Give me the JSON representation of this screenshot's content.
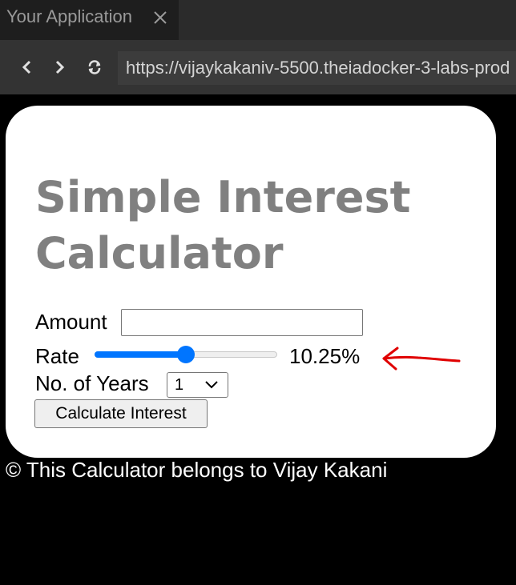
{
  "browser": {
    "tab_title": "Your Application",
    "url": "https://vijaykakaniv-5500.theiadocker-3-labs-prod",
    "icons": [
      "close-icon",
      "back-icon",
      "forward-icon",
      "reload-icon"
    ]
  },
  "calculator": {
    "title": "Simple Interest Calculator",
    "amount_label": "Amount",
    "amount_value": "",
    "rate_label": "Rate",
    "rate_fraction": 0.5,
    "rate_display": "10.25%",
    "years_label": "No. of Years",
    "years_selected": "1",
    "button_label": "Calculate Interest"
  },
  "footer": {
    "text": "© This Calculator belongs to Vijay Kakani"
  },
  "colors": {
    "accent": "#0075ff",
    "title": "#808080",
    "annotation": "#e00000"
  }
}
